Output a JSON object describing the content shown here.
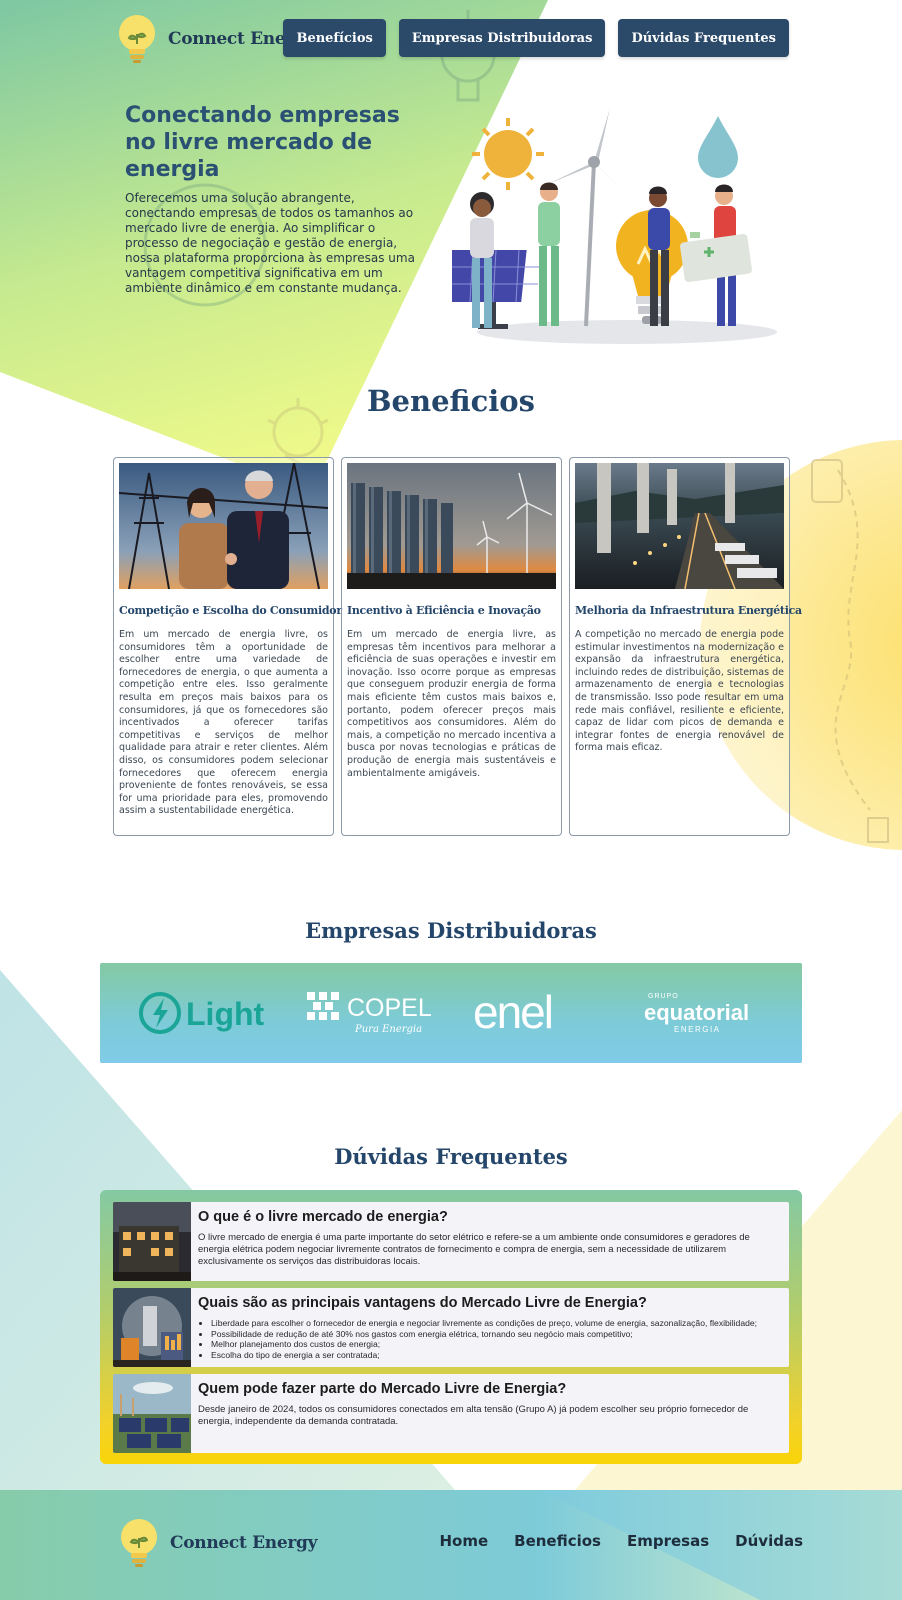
{
  "brand": {
    "name": "Connect Energy"
  },
  "nav": {
    "beneficios": "Benefícios",
    "empresas": "Empresas Distribuidoras",
    "duvidas": "Dúvidas Frequentes"
  },
  "hero": {
    "title": "Conectando empresas no livre mercado de energia",
    "text": "Oferecemos uma solução abrangente, conectando empresas de todos os tamanhos ao mercado livre de energia. Ao simplificar o processo de negociação e gestão de energia, nossa plataforma proporciona às empresas uma vantagem competitiva significativa em um ambiente dinâmico e em constante mudança."
  },
  "benefits": {
    "title": "Beneficios",
    "cards": [
      {
        "title": "Competição e Escolha do Consumidor",
        "text": "Em um mercado de energia livre, os consumidores têm a oportunidade de escolher entre uma variedade de fornecedores de energia, o que aumenta a competição entre eles. Isso geralmente resulta em preços mais baixos para os consumidores, já que os fornecedores são incentivados a oferecer tarifas competitivas e serviços de melhor qualidade para atrair e reter clientes. Além disso, os consumidores podem selecionar fornecedores que oferecem energia proveniente de fontes renováveis, se essa for uma prioridade para eles, promovendo assim a sustentabilidade energética."
      },
      {
        "title": "Incentivo à Eficiência e Inovação",
        "text": "Em um mercado de energia livre, as empresas têm incentivos para melhorar a eficiência de suas operações e investir em inovação. Isso ocorre porque as empresas que conseguem produzir energia de forma mais eficiente têm custos mais baixos e, portanto, podem oferecer preços mais competitivos aos consumidores. Além do mais, a competição no mercado incentiva a busca por novas tecnologias e práticas de produção de energia mais sustentáveis e ambientalmente amigáveis."
      },
      {
        "title": "Melhoria da Infraestrutura Energética",
        "text": "A competição no mercado de energia pode estimular investimentos na modernização e expansão da infraestrutura energética, incluindo redes de distribuição, sistemas de armazenamento de energia e tecnologias de transmissão. Isso pode resultar em uma rede mais confiável, resiliente e eficiente, capaz de lidar com picos de demanda e integrar fontes de energia renovável de forma mais eficaz."
      }
    ]
  },
  "distributors": {
    "title": "Empresas Distribuidoras",
    "logos": {
      "light": "Light",
      "copel": "COPEL",
      "copel_tagline": "Pura Energia",
      "enel": "enel",
      "equatorial_top": "GRUPO",
      "equatorial": "equatorial",
      "equatorial_bottom": "ENERGIA"
    }
  },
  "faq": {
    "title": "Dúvidas Frequentes",
    "items": [
      {
        "question": "O que é o livre mercado de energia?",
        "answer": "O livre mercado de energia é uma parte importante do setor elétrico e refere-se a um ambiente onde consumidores e geradores de energia elétrica podem negociar livremente contratos de fornecimento e compra de energia, sem a necessidade de utilizarem exclusivamente os serviços das distribuidoras locais."
      },
      {
        "question": "Quais são as principais vantagens do Mercado Livre de Energia?",
        "bullets": [
          "Liberdade para escolher o fornecedor de energia e negociar livremente as condições de preço, volume de energia, sazonalização, flexibilidade;",
          "Possibilidade de redução de até 30% nos gastos com energia elétrica, tornando seu negócio mais competitivo;",
          "Melhor planejamento dos custos de energia;",
          "Escolha do tipo de energia a ser contratada;"
        ]
      },
      {
        "question": "Quem pode fazer parte do Mercado Livre de Energia?",
        "answer": "Desde janeiro de 2024, todos os consumidores conectados em alta tensão (Grupo A) já podem escolher seu próprio fornecedor de energia, independente da demanda contratada."
      }
    ]
  },
  "footer": {
    "links": {
      "home": "Home",
      "beneficios": "Beneficios",
      "empresas": "Empresas",
      "duvidas": "Dúvidas"
    }
  },
  "colors": {
    "navy": "#2b4a69",
    "title_blue": "#24466a",
    "green_bg": "#84c9a3",
    "lime_bg": "#eaf78c",
    "yellow_bg": "#fbe07a",
    "teal_bg": "#80cbe8"
  }
}
